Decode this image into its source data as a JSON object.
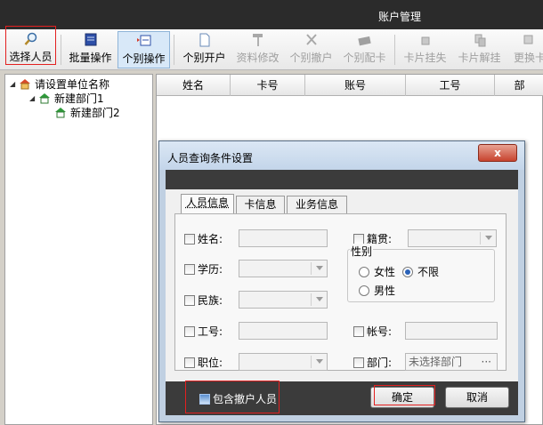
{
  "window": {
    "title": "账户管理"
  },
  "toolbar": {
    "buttons": [
      {
        "id": "select_person",
        "label": "选择人员",
        "icon": "magnifier-icon",
        "enabled": true
      },
      {
        "id": "batch",
        "label": "批量操作",
        "icon": "batch-icon",
        "enabled": true
      },
      {
        "id": "single",
        "label": "个别操作",
        "icon": "single-op-icon",
        "enabled": true,
        "active": true
      },
      {
        "id": "open_account",
        "label": "个别开户",
        "icon": "new-doc-icon",
        "enabled": true
      },
      {
        "id": "edit_info",
        "label": "资料修改",
        "icon": "hammer-icon",
        "enabled": false
      },
      {
        "id": "close_account",
        "label": "个别撤户",
        "icon": "x-icon",
        "enabled": false
      },
      {
        "id": "assign_card",
        "label": "个别配卡",
        "icon": "card-icon",
        "enabled": false
      },
      {
        "id": "card_lost",
        "label": "卡片挂失",
        "icon": "lock-icon",
        "enabled": false
      },
      {
        "id": "card_unlost",
        "label": "卡片解挂",
        "icon": "unlock-icon",
        "enabled": false
      },
      {
        "id": "change_card",
        "label": "更换卡",
        "icon": "swap-icon",
        "enabled": false
      }
    ]
  },
  "tree": {
    "root": "请设置单位名称",
    "children": [
      {
        "label": "新建部门1",
        "children": [
          {
            "label": "新建部门2"
          }
        ]
      }
    ]
  },
  "grid": {
    "columns": [
      "姓名",
      "卡号",
      "账号",
      "工号",
      "部"
    ]
  },
  "dialog": {
    "title": "人员查询条件设置",
    "close_label": "x",
    "tabs": [
      "人员信息",
      "卡信息",
      "业务信息"
    ],
    "fields": {
      "name": "姓名:",
      "education": "学历:",
      "ethnicity": "民族:",
      "employee_no": "工号:",
      "position": "职位:",
      "native_place": "籍贯:",
      "account_no": "帐号:",
      "department": "部门:"
    },
    "gender": {
      "label": "性别",
      "options": [
        "女性",
        "不限",
        "男性"
      ],
      "selected": "不限"
    },
    "department_value": "未选择部门",
    "department_more": "···",
    "include_closed": "包含撤户人员",
    "ok": "确定",
    "cancel": "取消"
  }
}
